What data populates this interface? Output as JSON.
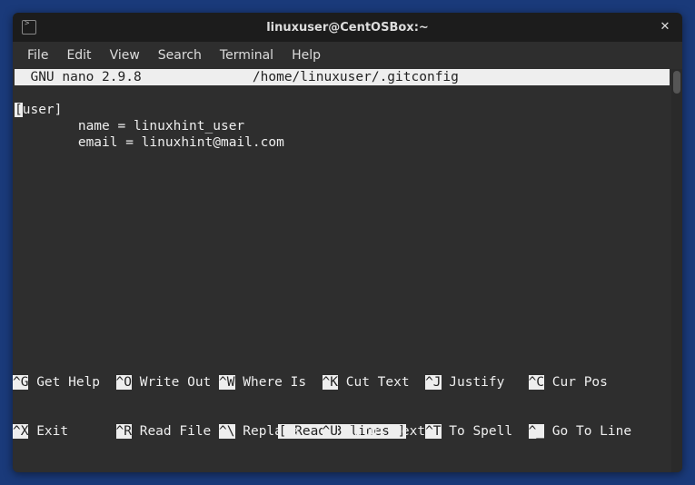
{
  "window": {
    "title": "linuxuser@CentOSBox:~"
  },
  "menubar": {
    "items": [
      "File",
      "Edit",
      "View",
      "Search",
      "Terminal",
      "Help"
    ]
  },
  "nano": {
    "app_version": "  GNU nano 2.9.8",
    "file_path": "/home/linuxuser/.gitconfig",
    "cursor_char": "[",
    "content_line1_rest": "user]",
    "content_line2": "        name = linuxhint_user",
    "content_line3": "        email = linuxhint@mail.com",
    "status": "[ Read 3 lines ]",
    "shortcuts_row1": [
      {
        "k": "^G",
        "l": "Get Help"
      },
      {
        "k": "^O",
        "l": "Write Out"
      },
      {
        "k": "^W",
        "l": "Where Is"
      },
      {
        "k": "^K",
        "l": "Cut Text"
      },
      {
        "k": "^J",
        "l": "Justify"
      },
      {
        "k": "^C",
        "l": "Cur Pos"
      }
    ],
    "shortcuts_row2": [
      {
        "k": "^X",
        "l": "Exit"
      },
      {
        "k": "^R",
        "l": "Read File"
      },
      {
        "k": "^\\",
        "l": "Replace"
      },
      {
        "k": "^U",
        "l": "Uncut Text"
      },
      {
        "k": "^T",
        "l": "To Spell"
      },
      {
        "k": "^_",
        "l": "Go To Line"
      }
    ]
  }
}
